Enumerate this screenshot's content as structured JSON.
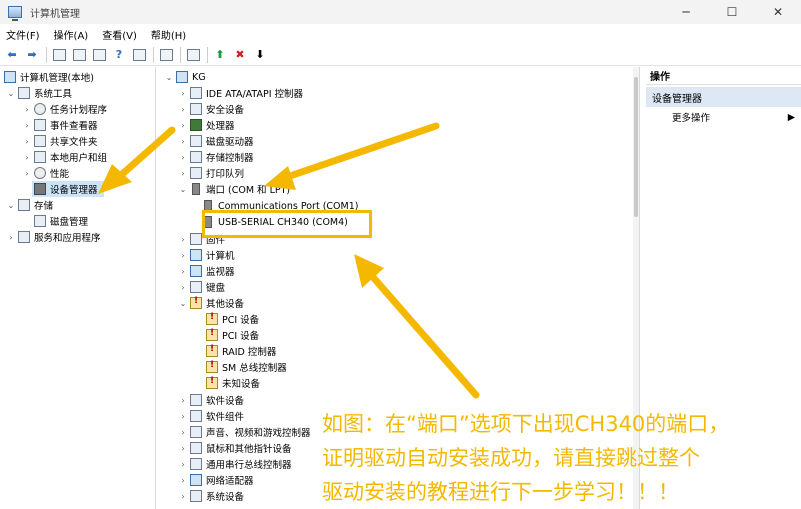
{
  "window": {
    "title": "计算机管理",
    "minimize": "─",
    "maximize": "☐",
    "close": "✕"
  },
  "menu": [
    "文件(F)",
    "操作(A)",
    "查看(V)",
    "帮助(H)"
  ],
  "left_tree": {
    "root": "计算机管理(本地)",
    "system_tools": "系统工具",
    "task_scheduler": "任务计划程序",
    "event_viewer": "事件查看器",
    "shared_folders": "共享文件夹",
    "local_users": "本地用户和组",
    "performance": "性能",
    "device_manager": "设备管理器",
    "storage": "存储",
    "disk_management": "磁盘管理",
    "services_apps": "服务和应用程序"
  },
  "devices": {
    "root": "KG",
    "ide": "IDE ATA/ATAPI 控制器",
    "security": "安全设备",
    "processor": "处理器",
    "disk_drives": "磁盘驱动器",
    "storage_ctrl": "存储控制器",
    "print_queue": "打印队列",
    "ports": "端口 (COM 和 LPT)",
    "com1": "Communications Port (COM1)",
    "com4": "USB-SERIAL CH340 (COM4)",
    "firmware": "固件",
    "computer": "计算机",
    "monitors": "监视器",
    "keyboard": "键盘",
    "other": "其他设备",
    "pci1": "PCI 设备",
    "pci2": "PCI 设备",
    "raid": "RAID 控制器",
    "smbus": "SM 总线控制器",
    "unknown": "未知设备",
    "software_dev": "软件设备",
    "software_comp": "软件组件",
    "audio": "声音、视频和游戏控制器",
    "mice": "鼠标和其他指针设备",
    "usb": "通用串行总线控制器",
    "network": "网络适配器",
    "system": "系统设备"
  },
  "actions": {
    "header": "操作",
    "section": "设备管理器",
    "more": "更多操作",
    "more_arrow": "▶"
  },
  "annotation": {
    "line1": "如图：在“端口”选项下出现CH340的端口，",
    "line2": "证明驱动自动安装成功，请直接跳过整个",
    "line3": "驱动安装的教程进行下一步学习！！！"
  },
  "colors": {
    "annotation": "#f5b800",
    "selection": "#cce4f7"
  }
}
